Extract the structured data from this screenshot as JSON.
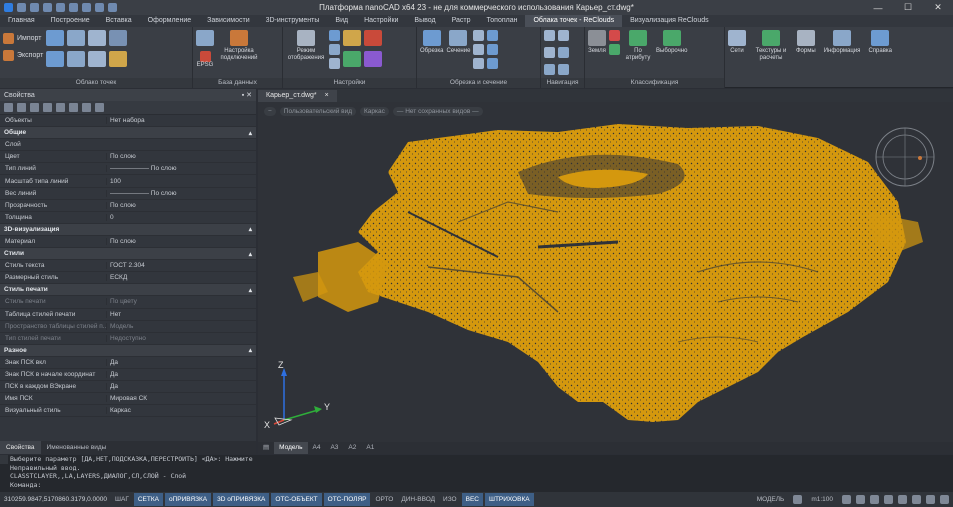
{
  "titlebar": {
    "title": "Платформа nanoCAD x64 23 - не для коммерческого использования Карьер_ст.dwg*"
  },
  "menu": [
    "Главная",
    "Построение",
    "Вставка",
    "Оформление",
    "Зависимости",
    "3D-инструменты",
    "Вид",
    "Настройки",
    "Вывод",
    "Растр",
    "Топоплан",
    "Облака точек - ReClouds",
    "Визуализация ReClouds"
  ],
  "menu_active_index": 11,
  "ribbon": {
    "g1": {
      "label": "Облако точек",
      "import": "Импорт",
      "export": "Экспорт"
    },
    "g2": {
      "label": "База данных",
      "epsg": "EPSG",
      "settings": "Настройка подключений"
    },
    "g3": {
      "label": "Настройки",
      "mode": "Режим отображения"
    },
    "g4": {
      "label": "Обрезка и сечение",
      "crop": "Обрезка",
      "section": "Сечение"
    },
    "g5": {
      "label": "Навигация"
    },
    "g6": {
      "label": "Классификация",
      "ground": "Земля",
      "by_attr": "По атрибуту",
      "selected": "Выборочно"
    },
    "g7": {
      "nets": "Сети",
      "textures": "Текстуры и расчеты",
      "forms": "Формы",
      "info": "Информация",
      "help": "Справка"
    }
  },
  "properties": {
    "title": "Свойства",
    "rows": [
      {
        "type": "prop",
        "k": "Объекты",
        "v": "Нет набора",
        "dim": false
      },
      {
        "type": "cat",
        "k": "Общие"
      },
      {
        "type": "prop",
        "k": "Слой",
        "v": "",
        "dim": false
      },
      {
        "type": "prop",
        "k": "Цвет",
        "v": "По слою",
        "dim": false
      },
      {
        "type": "prop",
        "k": "Тип линий",
        "v": "—————— По слою",
        "dim": false
      },
      {
        "type": "prop",
        "k": "Масштаб типа линий",
        "v": "100",
        "dim": false
      },
      {
        "type": "prop",
        "k": "Вес линий",
        "v": "—————— По слою",
        "dim": false
      },
      {
        "type": "prop",
        "k": "Прозрачность",
        "v": "По слою",
        "dim": false
      },
      {
        "type": "prop",
        "k": "Толщина",
        "v": "0",
        "dim": false
      },
      {
        "type": "cat",
        "k": "3D-визуализация"
      },
      {
        "type": "prop",
        "k": "Материал",
        "v": "По слою",
        "dim": false
      },
      {
        "type": "cat",
        "k": "Стили"
      },
      {
        "type": "prop",
        "k": "Стиль текста",
        "v": "ГОСТ 2.304",
        "dim": false
      },
      {
        "type": "prop",
        "k": "Размерный стиль",
        "v": "ЕСКД",
        "dim": false
      },
      {
        "type": "cat",
        "k": "Стиль печати"
      },
      {
        "type": "prop",
        "k": "Стиль печати",
        "v": "По цвету",
        "dim": true
      },
      {
        "type": "prop",
        "k": "Таблица стилей печати",
        "v": "Нет",
        "dim": false
      },
      {
        "type": "prop",
        "k": "Пространство таблицы стилей п...",
        "v": "Модель",
        "dim": true
      },
      {
        "type": "prop",
        "k": "Тип стилей печати",
        "v": "Недоступно",
        "dim": true
      },
      {
        "type": "cat",
        "k": "Разное"
      },
      {
        "type": "prop",
        "k": "Знак ПСК вкл",
        "v": "Да",
        "dim": false
      },
      {
        "type": "prop",
        "k": "Знак ПСК в начале координат",
        "v": "Да",
        "dim": false
      },
      {
        "type": "prop",
        "k": "ПСК в каждом ВЭкране",
        "v": "Да",
        "dim": false
      },
      {
        "type": "prop",
        "k": "Имя ПСК",
        "v": "Мировая СК",
        "dim": false
      },
      {
        "type": "prop",
        "k": "Визуальный стиль",
        "v": "Каркас",
        "dim": false
      }
    ],
    "tabs": [
      "Свойства",
      "Именованные виды"
    ]
  },
  "doc": {
    "tab": "Карьер_ст.dwg*",
    "close": "×",
    "view_controls": [
      "−",
      "Пользовательский вид",
      "Каркас",
      "— Нет сохранных видов —"
    ],
    "layout_tabs": [
      "Модель",
      "A4",
      "A3",
      "A2",
      "A1"
    ],
    "axes": {
      "x": "X",
      "y": "Y",
      "z": "Z"
    }
  },
  "command_lines": [
    "Выберите параметр [ДА,НЕТ,ПОДСКАЗКА,ПЕРЕСТРОИТЬ] <ДА>: Нажмите",
    "Неправильный ввод.",
    "CLASSTCLAYER,,LA,LAYERS,ДИАЛОГ,СЛ,СЛОЙ - Слой",
    "Команда:"
  ],
  "status": {
    "coords": "310259.9847,5170860.3179,0.0000",
    "buttons": [
      {
        "label": "ШАГ",
        "on": false
      },
      {
        "label": "СЕТКА",
        "on": true
      },
      {
        "label": "оПРИВЯЗКА",
        "on": true
      },
      {
        "label": "3D оПРИВЯЗКА",
        "on": true
      },
      {
        "label": "ОТС-ОБЪЕКТ",
        "on": true
      },
      {
        "label": "ОТС-ПОЛЯР",
        "on": true
      },
      {
        "label": "ОРТО",
        "on": false
      },
      {
        "label": "ДИН-ВВОД",
        "on": false
      },
      {
        "label": "ИЗО",
        "on": false
      },
      {
        "label": "ВЕС",
        "on": true
      },
      {
        "label": "ШТРИХОВКА",
        "on": true
      }
    ],
    "model": "МОДЕЛЬ",
    "scale": "m1:100"
  },
  "colors": {
    "point_cloud": "#d4980e",
    "accent": "#3e5f86"
  }
}
